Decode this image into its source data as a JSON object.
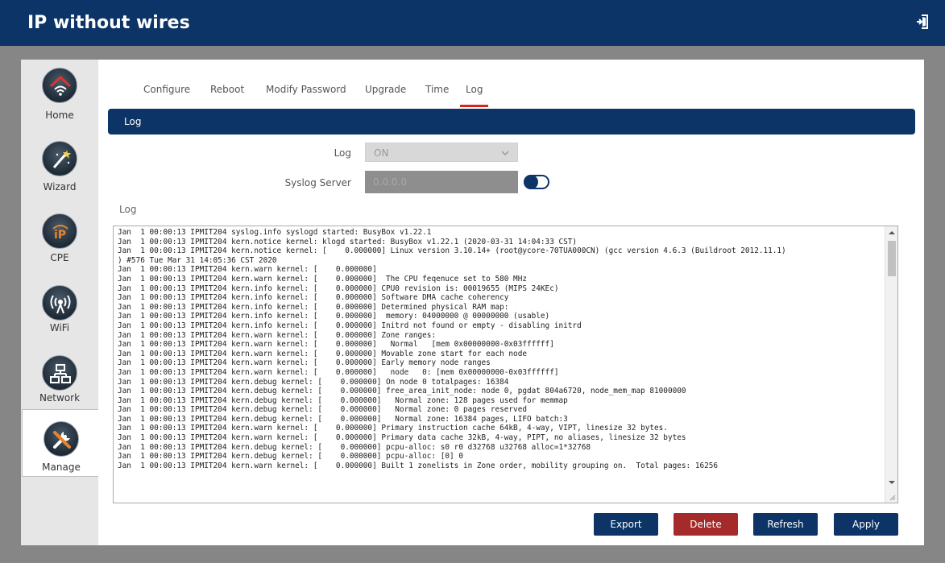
{
  "app": {
    "title": "IP without wires"
  },
  "sidebar": {
    "items": [
      {
        "label": "Home",
        "icon": "home-wifi-icon"
      },
      {
        "label": "Wizard",
        "icon": "wand-icon"
      },
      {
        "label": "CPE",
        "icon": "ip-mitter-logo-icon"
      },
      {
        "label": "WiFi",
        "icon": "antenna-icon"
      },
      {
        "label": "Network",
        "icon": "network-icon"
      },
      {
        "label": "Manage",
        "icon": "tools-icon",
        "active": true
      }
    ]
  },
  "tabs": [
    {
      "label": "Configure"
    },
    {
      "label": "Reboot"
    },
    {
      "label": "Modify Password"
    },
    {
      "label": "Upgrade"
    },
    {
      "label": "Time"
    },
    {
      "label": "Log",
      "active": true
    }
  ],
  "section": {
    "title": "Log"
  },
  "form": {
    "log_label": "Log",
    "log_value": "ON",
    "syslog_label": "Syslog Server",
    "syslog_value": "0.0.0.0",
    "syslog_enabled": true
  },
  "log": {
    "title": "Log",
    "lines": [
      "Jan  1 00:00:13 IPMIT204 syslog.info syslogd started: BusyBox v1.22.1",
      "Jan  1 00:00:13 IPMIT204 kern.notice kernel: klogd started: BusyBox v1.22.1 (2020-03-31 14:04:33 CST)",
      "Jan  1 00:00:13 IPMIT204 kern.notice kernel: [    0.000000] Linux version 3.10.14+ (root@ycore-70TUA000CN) (gcc version 4.6.3 (Buildroot 2012.11.1)",
      ") #576 Tue Mar 31 14:05:36 CST 2020",
      "Jan  1 00:00:13 IPMIT204 kern.warn kernel: [    0.000000]",
      "Jan  1 00:00:13 IPMIT204 kern.warn kernel: [    0.000000]  The CPU feqenuce set to 580 MHz",
      "Jan  1 00:00:13 IPMIT204 kern.info kernel: [    0.000000] CPU0 revision is: 00019655 (MIPS 24KEc)",
      "Jan  1 00:00:13 IPMIT204 kern.info kernel: [    0.000000] Software DMA cache coherency",
      "Jan  1 00:00:13 IPMIT204 kern.info kernel: [    0.000000] Determined physical RAM map:",
      "Jan  1 00:00:13 IPMIT204 kern.info kernel: [    0.000000]  memory: 04000000 @ 00000000 (usable)",
      "Jan  1 00:00:13 IPMIT204 kern.info kernel: [    0.000000] Initrd not found or empty - disabling initrd",
      "Jan  1 00:00:13 IPMIT204 kern.warn kernel: [    0.000000] Zone ranges:",
      "Jan  1 00:00:13 IPMIT204 kern.warn kernel: [    0.000000]   Normal   [mem 0x00000000-0x03ffffff]",
      "Jan  1 00:00:13 IPMIT204 kern.warn kernel: [    0.000000] Movable zone start for each node",
      "Jan  1 00:00:13 IPMIT204 kern.warn kernel: [    0.000000] Early memory node ranges",
      "Jan  1 00:00:13 IPMIT204 kern.warn kernel: [    0.000000]   node   0: [mem 0x00000000-0x03ffffff]",
      "Jan  1 00:00:13 IPMIT204 kern.debug kernel: [    0.000000] On node 0 totalpages: 16384",
      "Jan  1 00:00:13 IPMIT204 kern.debug kernel: [    0.000000] free_area_init_node: node 0, pgdat 804a6720, node_mem_map 81000000",
      "Jan  1 00:00:13 IPMIT204 kern.debug kernel: [    0.000000]   Normal zone: 128 pages used for memmap",
      "Jan  1 00:00:13 IPMIT204 kern.debug kernel: [    0.000000]   Normal zone: 0 pages reserved",
      "Jan  1 00:00:13 IPMIT204 kern.debug kernel: [    0.000000]   Normal zone: 16384 pages, LIFO batch:3",
      "Jan  1 00:00:13 IPMIT204 kern.warn kernel: [    0.000000] Primary instruction cache 64kB, 4-way, VIPT, linesize 32 bytes.",
      "Jan  1 00:00:13 IPMIT204 kern.warn kernel: [    0.000000] Primary data cache 32kB, 4-way, PIPT, no aliases, linesize 32 bytes",
      "Jan  1 00:00:13 IPMIT204 kern.debug kernel: [    0.000000] pcpu-alloc: s0 r0 d32768 u32768 alloc=1*32768",
      "Jan  1 00:00:13 IPMIT204 kern.debug kernel: [    0.000000] pcpu-alloc: [0] 0",
      "Jan  1 00:00:13 IPMIT204 kern.warn kernel: [    0.000000] Built 1 zonelists in Zone order, mobility grouping on.  Total pages: 16256"
    ]
  },
  "buttons": {
    "export": "Export",
    "delete": "Delete",
    "refresh": "Refresh",
    "apply": "Apply"
  },
  "colors": {
    "header": "#0c3466",
    "active_tab_underline": "#d9251d",
    "delete": "#a52a2a"
  }
}
